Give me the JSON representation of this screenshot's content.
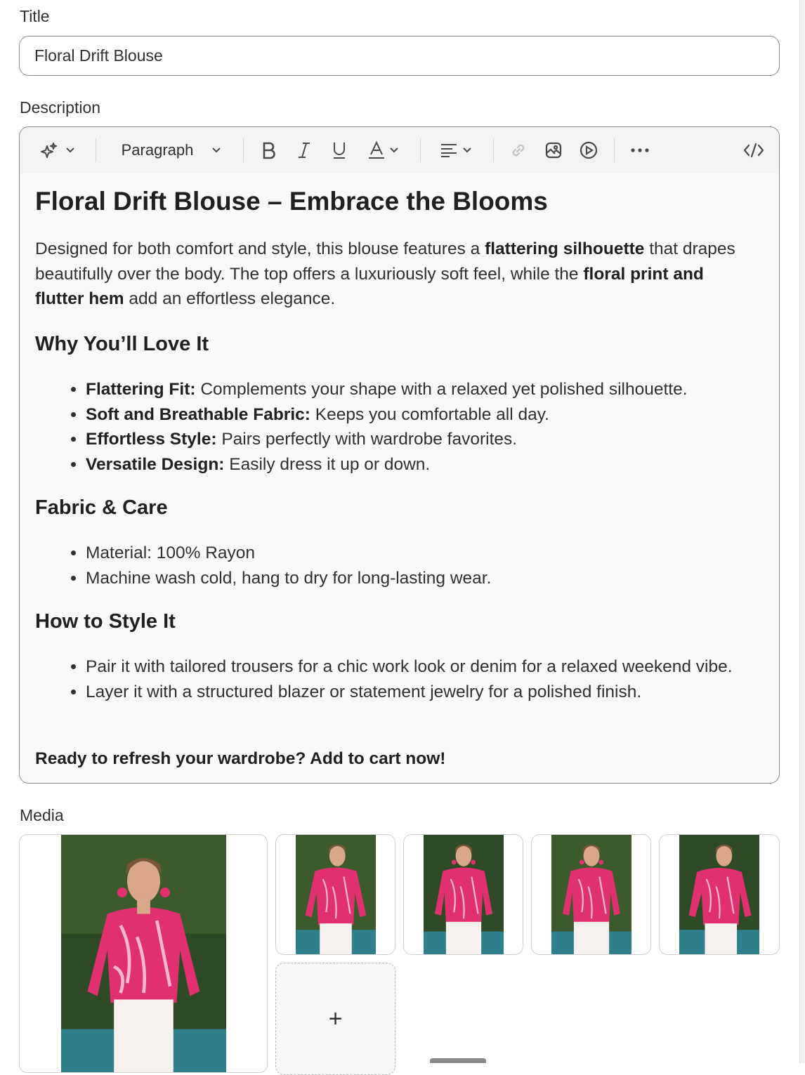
{
  "title_field": {
    "label": "Title",
    "value": "Floral Drift Blouse"
  },
  "description_field": {
    "label": "Description",
    "toolbar": {
      "ai_icon": "sparkle-icon",
      "format_select": "Paragraph",
      "buttons": [
        "bold-icon",
        "italic-icon",
        "underline-icon",
        "text-color-icon",
        "align-icon",
        "link-icon",
        "image-icon",
        "video-icon",
        "more-icon",
        "code-icon"
      ]
    },
    "content": {
      "heading": "Floral Drift Blouse – Embrace the Blooms",
      "intro": {
        "t1": "Designed for both comfort and style, this blouse features a ",
        "b1": "flattering silhouette",
        "t2": " that drapes beautifully over the body. The top offers a luxuriously soft feel, while the ",
        "b2": "floral print and flutter hem",
        "t3": " add an effortless elegance."
      },
      "section1": {
        "title": "Why You’ll Love It",
        "items": [
          {
            "bold": "Flattering Fit:",
            "text": " Complements your shape with a relaxed yet polished silhouette."
          },
          {
            "bold": "Soft and Breathable Fabric:",
            "text": " Keeps you comfortable all day."
          },
          {
            "bold": "Effortless Style:",
            "text": " Pairs perfectly with wardrobe favorites."
          },
          {
            "bold": "Versatile Design:",
            "text": " Easily dress it up or down."
          }
        ]
      },
      "section2": {
        "title": "Fabric & Care",
        "items": [
          "Material: 100% Rayon",
          "Machine wash cold, hang to dry for long-lasting wear."
        ]
      },
      "section3": {
        "title": "How to Style It",
        "items": [
          "Pair it with tailored trousers for a chic work look or denim for a relaxed weekend vibe.",
          "Layer it with a structured blazer or statement jewelry for a polished finish."
        ]
      },
      "cta": "Ready to refresh your wardrobe? Add to cart now!"
    }
  },
  "media": {
    "label": "Media",
    "add_label": "+",
    "colors": {
      "blouse": "#e0306f",
      "print": "#f7b7cf",
      "pants": "#f6f1ee",
      "foliage": "#2f4a26",
      "water": "#2f7f8c"
    }
  }
}
